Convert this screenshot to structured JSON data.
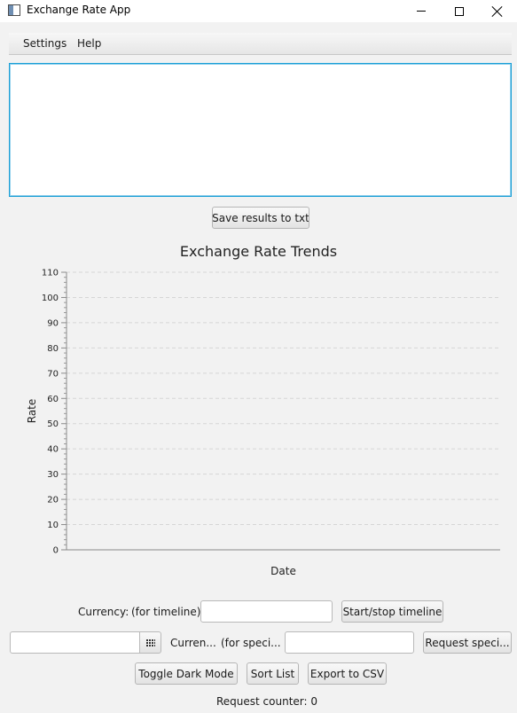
{
  "window": {
    "title": "Exchange Rate App"
  },
  "menu": {
    "items": [
      "Settings",
      "Help"
    ]
  },
  "results": {
    "text": ""
  },
  "buttons": {
    "save": "Save results to txt",
    "timeline": "Start/stop timeline",
    "request": "Request speci...",
    "dark_mode": "Toggle Dark Mode",
    "sort": "Sort List",
    "export": "Export to CSV"
  },
  "labels": {
    "currency": "Currency:",
    "for_timeline": "(for timeline)",
    "currency_short": "Curren...",
    "for_specific": "(for speci...",
    "request_counter": "Request counter: 0"
  },
  "inputs": {
    "timeline_currency": "",
    "specific_currency": "",
    "date": ""
  },
  "icons": {
    "date_picker": "calendar-icon"
  },
  "chart_data": {
    "type": "line",
    "title": "Exchange Rate Trends",
    "xlabel": "Date",
    "ylabel": "Rate",
    "ylim": [
      0,
      110
    ],
    "yticks": [
      0,
      10,
      20,
      30,
      40,
      50,
      60,
      70,
      80,
      90,
      100,
      110
    ],
    "series": [],
    "grid": true
  }
}
